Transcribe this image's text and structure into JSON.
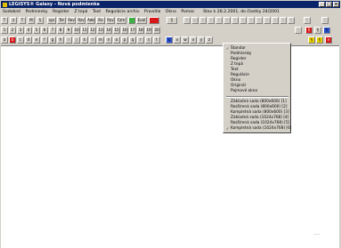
{
  "window": {
    "title": "LEGISYS® Galaxy - Nová podmienka",
    "buttons": [
      "_",
      "□",
      "×"
    ]
  },
  "menu": {
    "items": [
      "Sodobné",
      "Podmienky",
      "Register",
      "Z tepá",
      "Text",
      "Regulácie archiv",
      "Pravídla",
      "Okno",
      "Pomoc"
    ],
    "status": "Stav k 28.2.2001, do čiastky 24/2001"
  },
  "toolbar1": {
    "buttons": [
      "T",
      "z",
      "T",
      "M",
      "§",
      "sys",
      "Tel",
      "Rev",
      "Rzv",
      "Aeb",
      "Rx",
      "Rxv",
      "Fzm",
      "Eval",
      "§",
      "§",
      "sync",
      "§",
      "§",
      "§",
      "§",
      "§",
      "§",
      "§",
      "§",
      "§",
      "§",
      "§",
      "§",
      "§",
      "§"
    ]
  },
  "toolbar2": {
    "buttons": [
      "1",
      "2",
      "3",
      "4",
      "5",
      "6",
      "7",
      "8",
      "9",
      "10",
      "11",
      "12",
      "13",
      "14",
      "15",
      "16",
      "17",
      "18",
      "19",
      "20",
      "§",
      "§",
      "§",
      "§"
    ]
  },
  "toolbar3": {
    "buttons": [
      "a",
      "b",
      "c",
      "d",
      "e",
      "f",
      "g",
      "h",
      "i",
      "j",
      "k",
      "l",
      "m",
      "n",
      "o",
      "p",
      "q",
      "r",
      "s",
      "t",
      "u",
      "v",
      "w",
      "x",
      "y",
      "z",
      "§",
      "§",
      "×"
    ]
  },
  "dropdown": {
    "items": [
      {
        "label": "Štandar",
        "checked": true
      },
      {
        "label": "Podmienky",
        "checked": false
      },
      {
        "label": "Register",
        "checked": false
      },
      {
        "label": "Z tepá",
        "checked": false
      },
      {
        "label": "Text",
        "checked": false
      },
      {
        "label": "Regulácie",
        "checked": false
      },
      {
        "label": "Okno",
        "checked": false
      },
      {
        "label": "Originál",
        "checked": false
      },
      {
        "label": "Pojmové okno",
        "checked": false
      }
    ],
    "items2": [
      {
        "label": "Základná sada (800x600) [1]",
        "checked": false
      },
      {
        "label": "Rozšírená sada (800x600) [2]",
        "checked": false
      },
      {
        "label": "Kompletná sada (800x600) [3]",
        "checked": false
      },
      {
        "label": "Základná sada (1024x768) [4]",
        "checked": false
      },
      {
        "label": "Rozšírená sada (1024x768) [5]",
        "checked": false
      },
      {
        "label": "Kompletná sada (1024x768) [6]",
        "checked": true
      }
    ]
  }
}
